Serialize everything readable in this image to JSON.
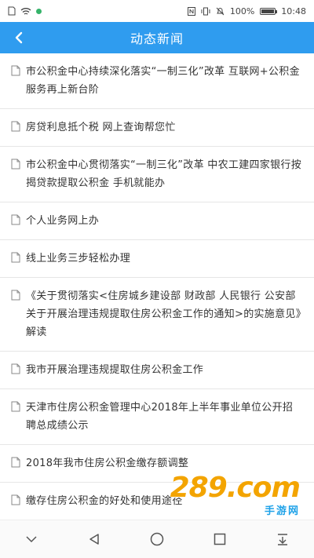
{
  "status": {
    "battery": "100%",
    "time": "10:48",
    "battery_level": 1.0
  },
  "header": {
    "title": "动态新闻"
  },
  "news": [
    {
      "text": "市公积金中心持续深化落实“一制三化”改革 互联网+公积金服务再上新台阶"
    },
    {
      "text": "房贷利息抵个税 网上查询帮您忙"
    },
    {
      "text": "市公积金中心贯彻落实“一制三化”改革 中农工建四家银行按揭贷款提取公积金 手机就能办"
    },
    {
      "text": "个人业务网上办"
    },
    {
      "text": "线上业务三步轻松办理"
    },
    {
      "text": "《关于贯彻落实<住房城乡建设部 财政部 人民银行 公安部关于开展治理违规提取住房公积金工作的通知>的实施意见》解读"
    },
    {
      "text": "我市开展治理违规提取住房公积金工作"
    },
    {
      "text": "天津市住房公积金管理中心2018年上半年事业单位公开招聘总成绩公示"
    },
    {
      "text": "2018年我市住房公积金缴存额调整"
    },
    {
      "text": "缴存住房公积金的好处和使用途径"
    }
  ],
  "watermark": {
    "brand": "289.com",
    "sub": "手游网"
  },
  "colors": {
    "accent": "#2f9cef",
    "text": "#333333",
    "divider": "#e6e6e6"
  }
}
